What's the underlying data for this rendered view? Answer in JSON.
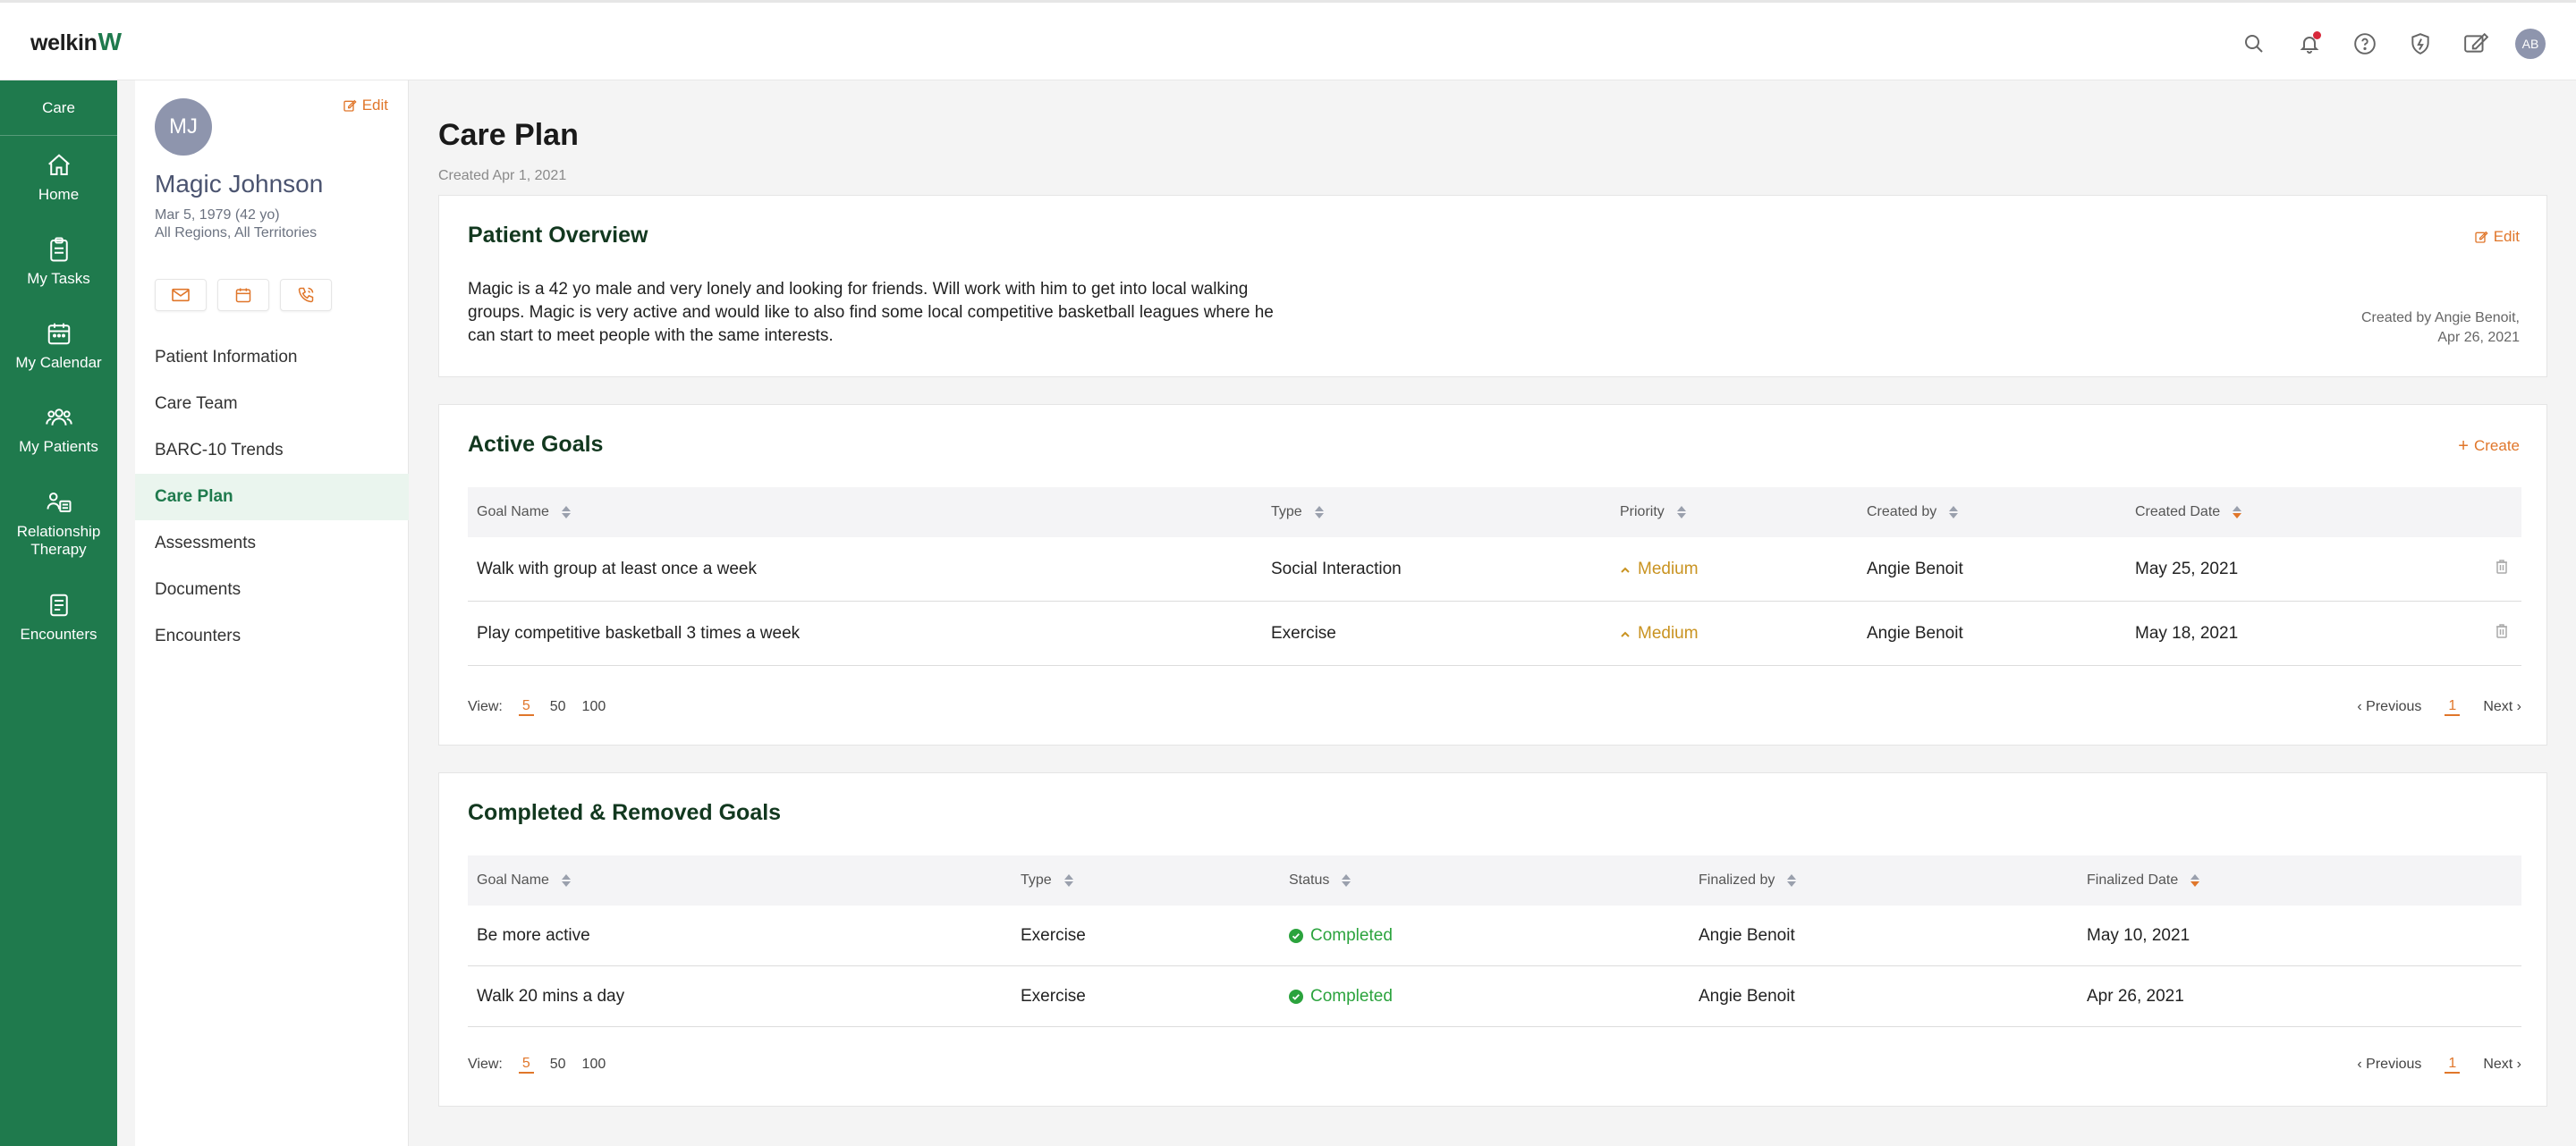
{
  "app": {
    "logo_text": "welkin",
    "logo_mark": "W"
  },
  "topbar": {
    "icons": [
      "search-icon",
      "bell-icon",
      "help-icon",
      "shield-icon",
      "pen-icon"
    ],
    "user_initials": "AB"
  },
  "leftnav": {
    "header": "Care",
    "items": [
      {
        "label": "Home",
        "icon": "home-icon"
      },
      {
        "label": "My Tasks",
        "icon": "clipboard-icon"
      },
      {
        "label": "My Calendar",
        "icon": "calendar-icon"
      },
      {
        "label": "My Patients",
        "icon": "users-icon"
      },
      {
        "label": "Relationship Therapy",
        "icon": "relationship-icon"
      },
      {
        "label": "Encounters",
        "icon": "document-icon"
      }
    ]
  },
  "patient": {
    "initials": "MJ",
    "edit_label": "Edit",
    "name": "Magic Johnson",
    "dob": "Mar 5, 1979 (42 yo)",
    "region": "All Regions, All Territories",
    "actions": [
      "mail-icon",
      "calendar-icon",
      "phone-icon"
    ],
    "menu": [
      {
        "label": "Patient Information"
      },
      {
        "label": "Care Team"
      },
      {
        "label": "BARC-10 Trends"
      },
      {
        "label": "Care Plan",
        "active": true
      },
      {
        "label": "Assessments"
      },
      {
        "label": "Documents"
      },
      {
        "label": "Encounters"
      }
    ]
  },
  "main": {
    "title": "Care Plan",
    "subtitle": "Created Apr 1, 2021",
    "overview": {
      "title": "Patient Overview",
      "edit_label": "Edit",
      "text": "Magic is a 42 yo male and very lonely and looking for friends. Will work with him to get into local walking groups. Magic is very active and would like to also find some local competitive basketball leagues where he can start to meet people with the same interests.",
      "meta_line1": "Created by Angie Benoit,",
      "meta_line2": "Apr 26, 2021"
    },
    "active_goals": {
      "title": "Active Goals",
      "create_label": "Create",
      "columns": [
        "Goal Name",
        "Type",
        "Priority",
        "Created by",
        "Created Date"
      ],
      "rows": [
        {
          "name": "Walk with group at least once a week",
          "type": "Social Interaction",
          "priority": "Medium",
          "created_by": "Angie Benoit",
          "date": "May 25, 2021"
        },
        {
          "name": "Play competitive basketball 3 times a week",
          "type": "Exercise",
          "priority": "Medium",
          "created_by": "Angie Benoit",
          "date": "May 18, 2021"
        }
      ],
      "pager": {
        "view_label": "View:",
        "sizes": [
          "5",
          "50",
          "100"
        ],
        "prev": "‹ Previous",
        "page": "1",
        "next": "Next ›"
      }
    },
    "completed_goals": {
      "title": "Completed & Removed Goals",
      "columns": [
        "Goal Name",
        "Type",
        "Status",
        "Finalized by",
        "Finalized Date"
      ],
      "rows": [
        {
          "name": "Be more active",
          "type": "Exercise",
          "status": "Completed",
          "finalized_by": "Angie Benoit",
          "date": "May 10, 2021"
        },
        {
          "name": "Walk 20 mins a day",
          "type": "Exercise",
          "status": "Completed",
          "finalized_by": "Angie Benoit",
          "date": "Apr 26, 2021"
        }
      ],
      "pager": {
        "view_label": "View:",
        "sizes": [
          "5",
          "50",
          "100"
        ],
        "prev": "‹ Previous",
        "page": "1",
        "next": "Next ›"
      }
    }
  },
  "colors": {
    "brand": "#1f7a4d",
    "accent": "#e0762a",
    "priority": "#c99321",
    "success": "#2ba33d"
  }
}
